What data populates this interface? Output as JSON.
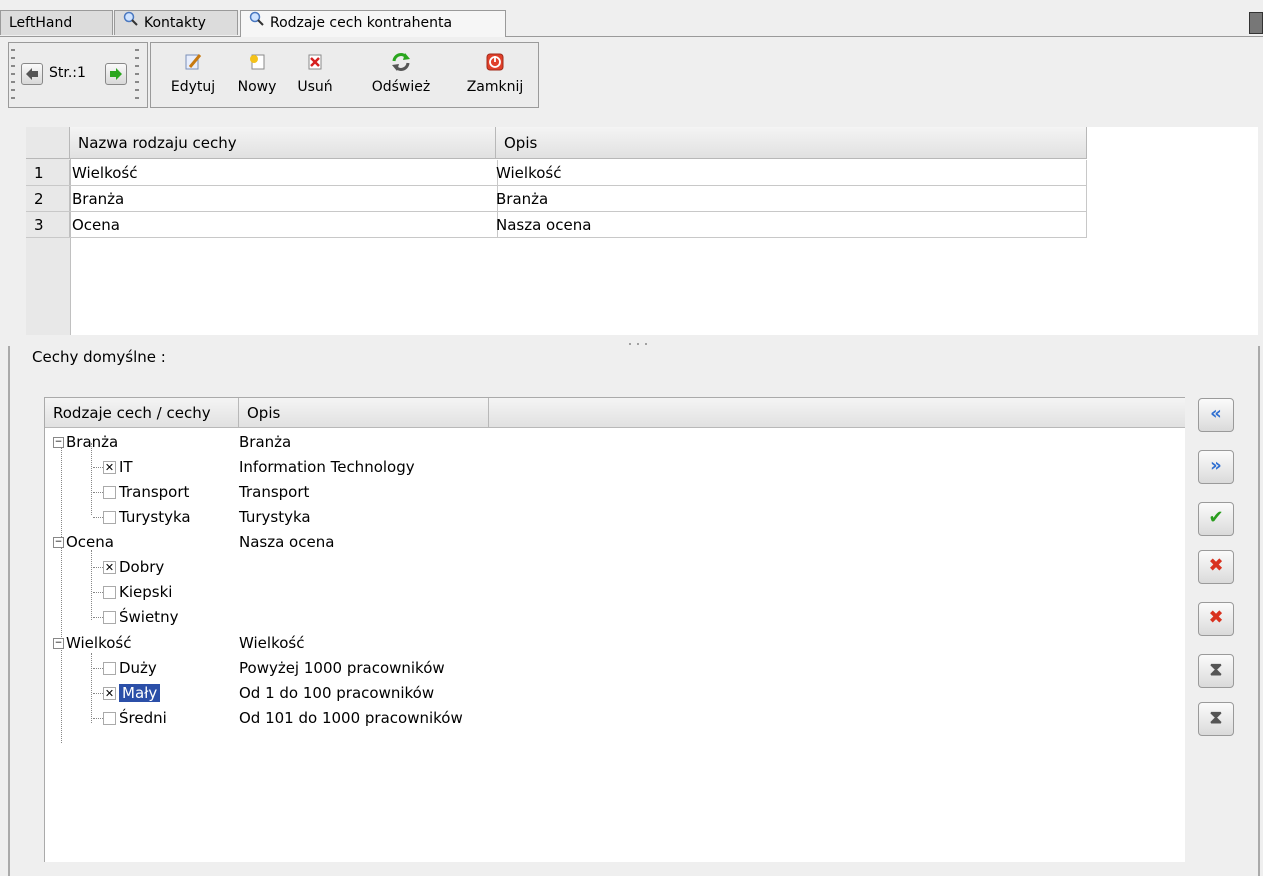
{
  "tabs": [
    {
      "label": "LeftHand"
    },
    {
      "label": "Kontakty"
    },
    {
      "label": "Rodzaje cech kontrahenta"
    }
  ],
  "pager": {
    "label": "Str.:1"
  },
  "toolbar": {
    "edit": "Edytuj",
    "new": "Nowy",
    "delete": "Usuń",
    "refresh": "Odśwież",
    "close": "Zamknij"
  },
  "top_table": {
    "columns": [
      "Nazwa rodzaju cechy",
      "Opis"
    ],
    "rows": [
      {
        "num": "1",
        "name": "Wielkość",
        "desc": "Wielkość"
      },
      {
        "num": "2",
        "name": "Branża",
        "desc": "Branża"
      },
      {
        "num": "3",
        "name": "Ocena",
        "desc": "Nasza ocena"
      }
    ]
  },
  "section_label": "Cechy domyślne :",
  "tree": {
    "columns": [
      "Rodzaje cech / cechy",
      "Opis"
    ],
    "groups": [
      {
        "name": "Branża",
        "desc": "Branża",
        "items": [
          {
            "name": "IT",
            "desc": "Information Technology",
            "checked": true
          },
          {
            "name": "Transport",
            "desc": "Transport",
            "checked": false
          },
          {
            "name": "Turystyka",
            "desc": "Turystyka",
            "checked": false
          }
        ]
      },
      {
        "name": "Ocena",
        "desc": "Nasza ocena",
        "items": [
          {
            "name": "Dobry",
            "desc": "",
            "checked": true
          },
          {
            "name": "Kiepski",
            "desc": "",
            "checked": false
          },
          {
            "name": "Świetny",
            "desc": "",
            "checked": false
          }
        ]
      },
      {
        "name": "Wielkość",
        "desc": "Wielkość",
        "items": [
          {
            "name": "Duży",
            "desc": "Powyżej 1000 pracowników",
            "checked": false
          },
          {
            "name": "Mały",
            "desc": "Od 1 do 100 pracowników",
            "checked": true
          },
          {
            "name": "Średni",
            "desc": "Od 101 do 1000 pracowników",
            "checked": false
          }
        ]
      }
    ]
  },
  "side_buttons": [
    {
      "icon": "rewind-icon",
      "glyph": "«"
    },
    {
      "icon": "fast-forward-icon",
      "glyph": "»"
    },
    {
      "icon": "check-icon",
      "glyph": "✔"
    },
    {
      "icon": "cross-icon",
      "glyph": "✖"
    },
    {
      "icon": "check-cross-icon",
      "glyph": "✖"
    },
    {
      "icon": "move-down-icon",
      "glyph": "⧗"
    },
    {
      "icon": "move-up-icon",
      "glyph": "⧗"
    }
  ],
  "colors": {
    "selection": "#2b4fa8",
    "check": "#2a9d1e",
    "cross": "#d9321f",
    "nav": "#2f6fd1"
  }
}
